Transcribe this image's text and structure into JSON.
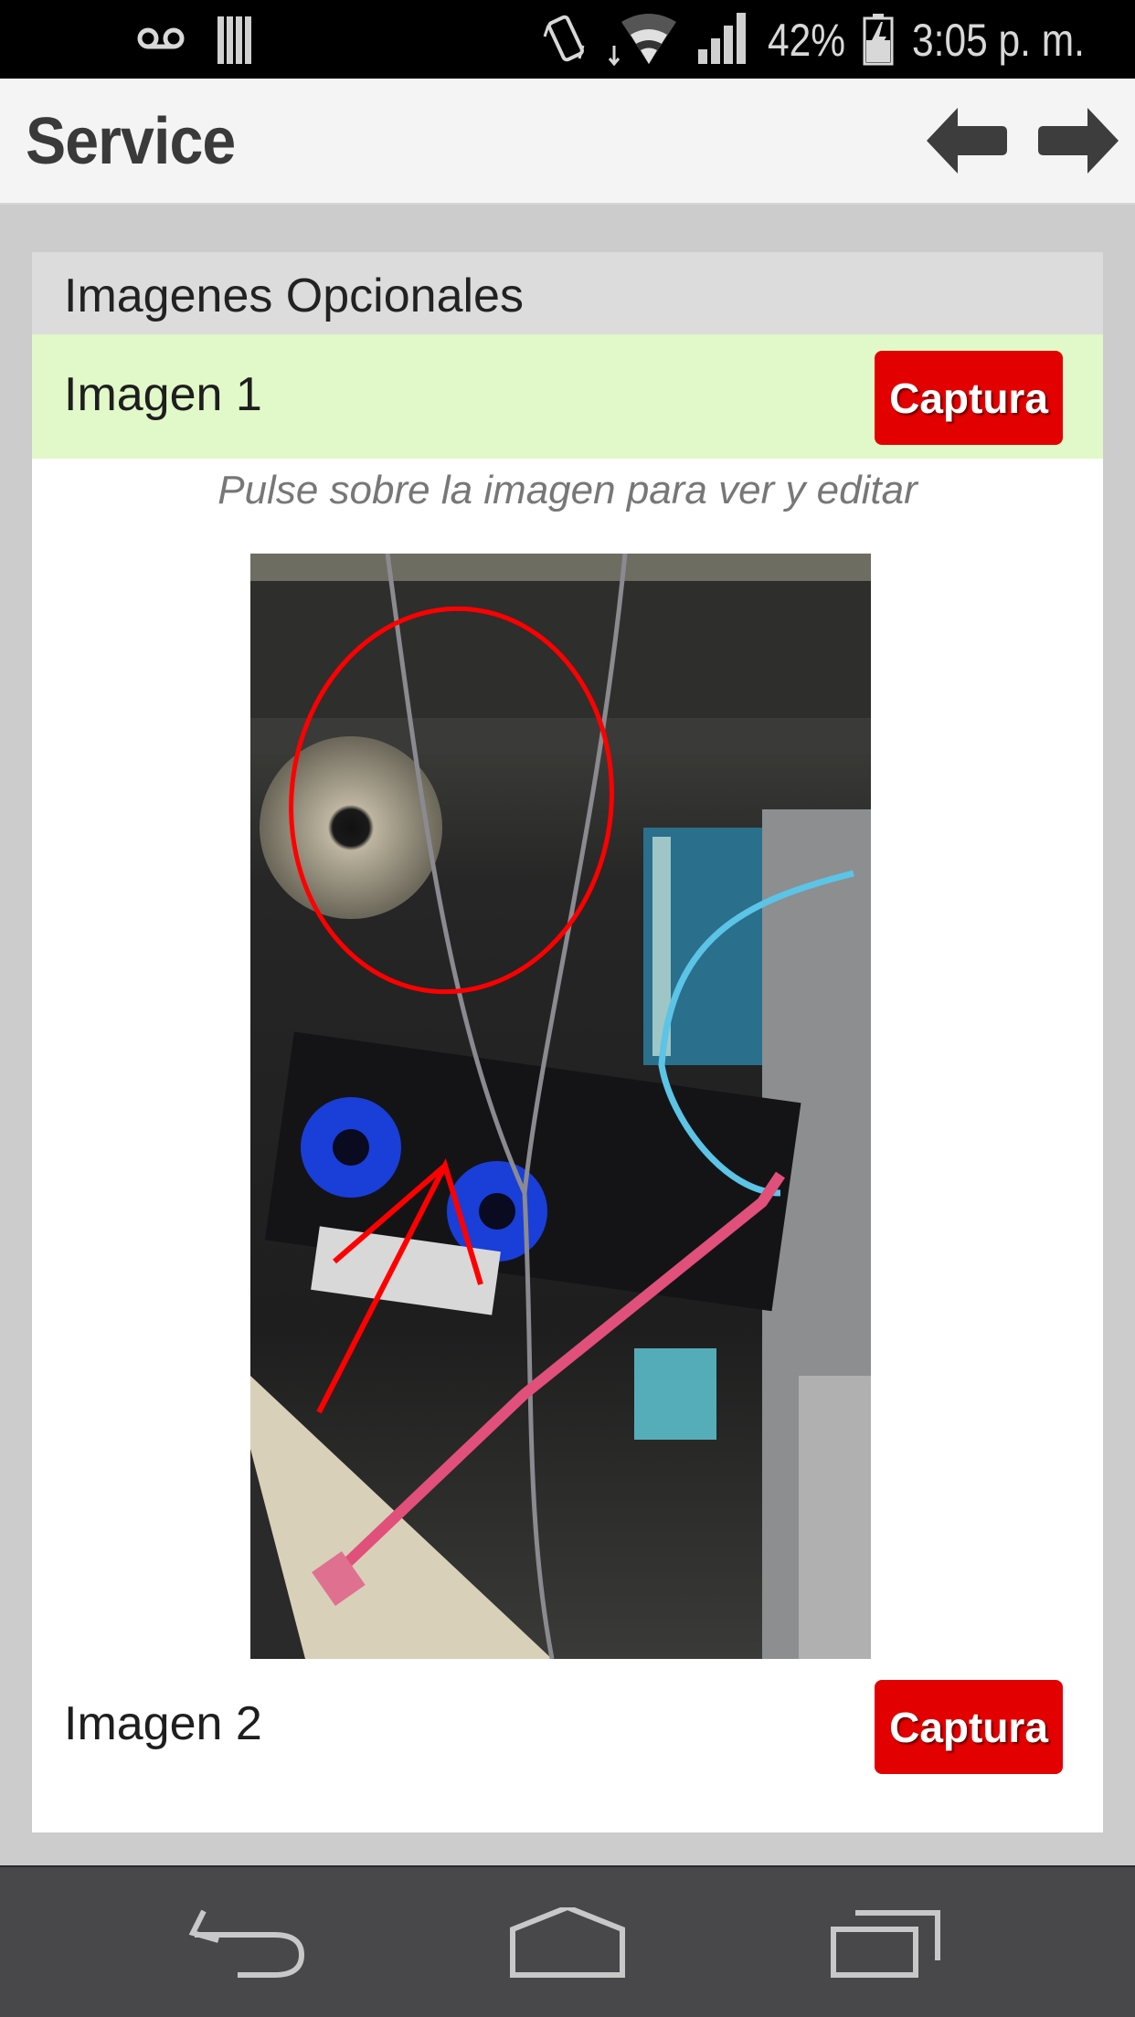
{
  "status_bar": {
    "battery_percent": "42%",
    "time": "3:05 p. m.",
    "icons": [
      "voicemail-icon",
      "sim-card-icon",
      "vibrate-icon",
      "wifi-icon",
      "signal-icon",
      "battery-charging-icon"
    ]
  },
  "header": {
    "title": "Service",
    "back_icon": "arrow-left-icon",
    "forward_icon": "arrow-right-icon"
  },
  "section": {
    "title": "Imagenes Opcionales",
    "hint": "Pulse sobre la imagen para ver y editar",
    "items": [
      {
        "label": "Imagen 1",
        "button_label": "Captura",
        "has_image": true,
        "highlight_color": "#e1f8c8"
      },
      {
        "label": "Imagen 2",
        "button_label": "Captura",
        "has_image": false
      }
    ]
  },
  "colors": {
    "accent_button": "#e30000",
    "highlight_row": "#e1f8c8",
    "section_header": "#dcdcdc",
    "page_background": "#cccccc"
  },
  "nav_bar": {
    "buttons": [
      "back-icon",
      "home-icon",
      "recent-apps-icon"
    ]
  }
}
